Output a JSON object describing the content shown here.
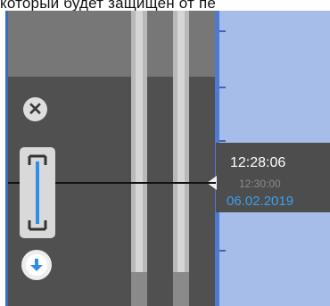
{
  "caption": {
    "text": "который будет защищен от пе"
  },
  "timeline": {
    "current_time": "12:28:06",
    "ghost_time": "12:30:00",
    "current_date": "06.02.2019"
  },
  "controls": {
    "close_icon": "close-icon",
    "range_icon": "range-bracket-icon",
    "down_icon": "arrow-down-icon"
  },
  "colors": {
    "ruler_bg": "#a7bde9",
    "panel_dark": "#505050",
    "date_text": "#3aa0ee",
    "accent_blue": "#2f8fe8"
  }
}
